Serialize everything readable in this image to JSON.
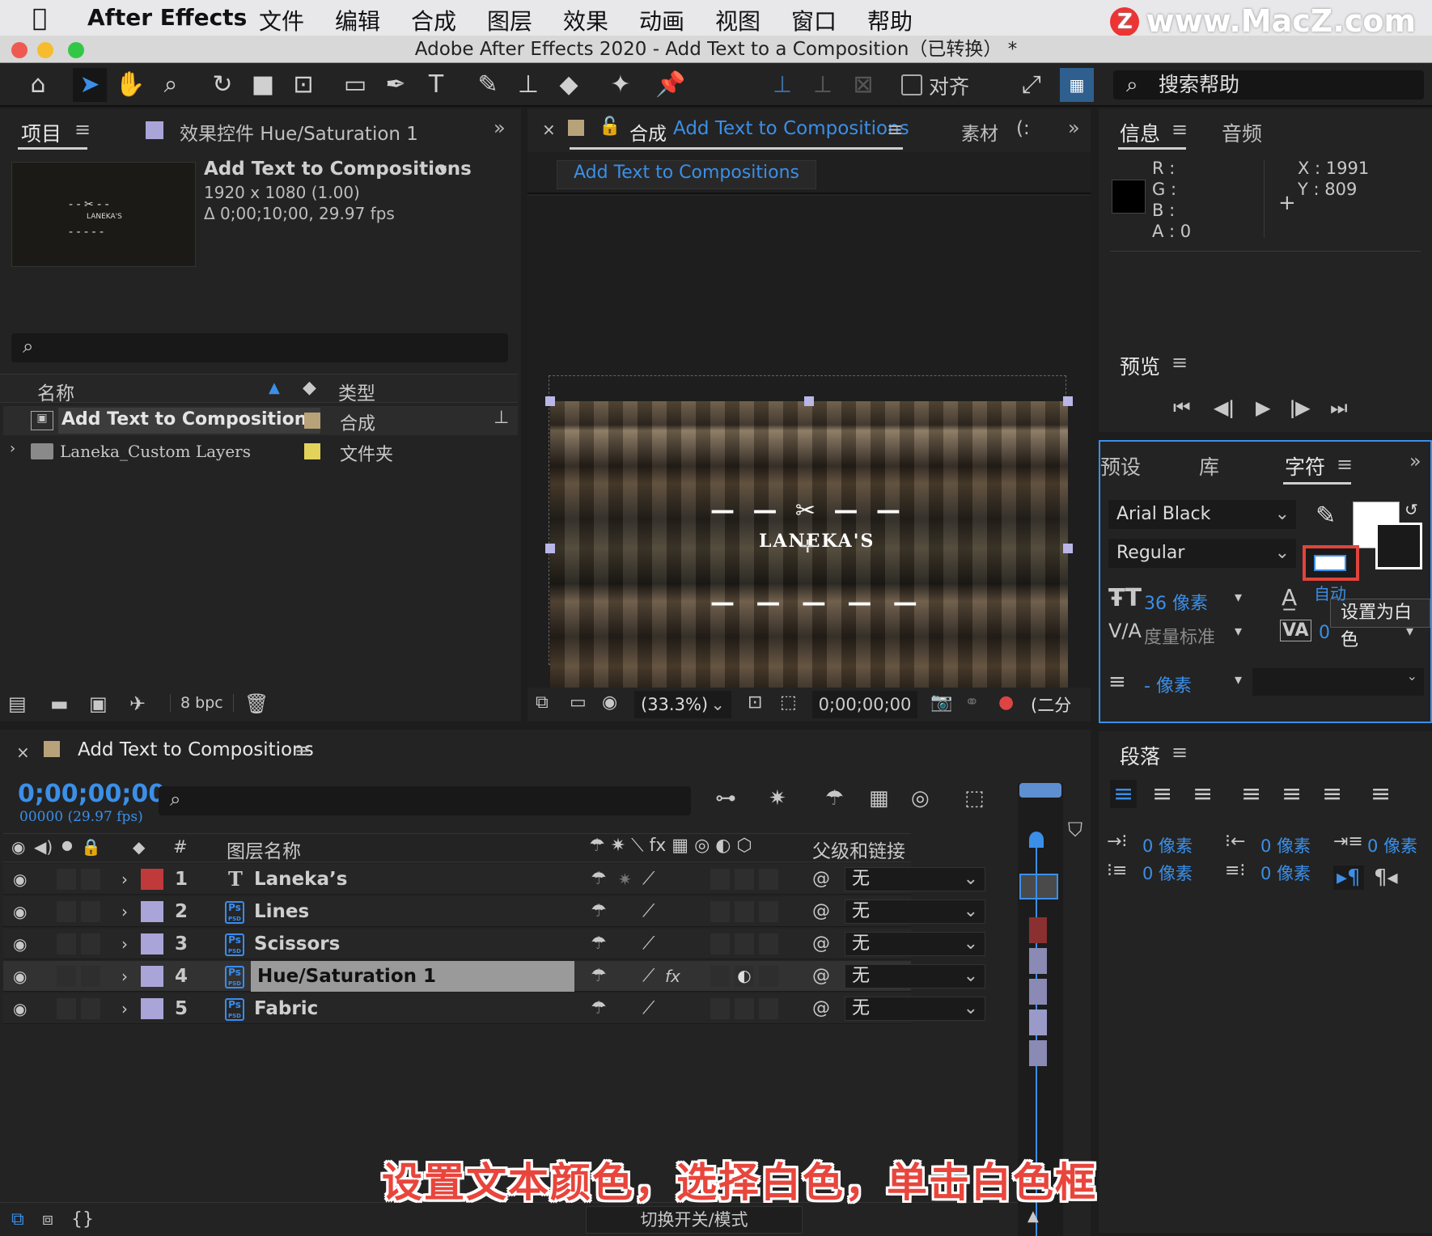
{
  "menubar": {
    "apple": "",
    "items": [
      "After Effects",
      "文件",
      "编辑",
      "合成",
      "图层",
      "效果",
      "动画",
      "视图",
      "窗口",
      "帮助"
    ],
    "watermark": "www.MacZ.com",
    "watermark_badge": "Z"
  },
  "window": {
    "title": "Adobe After Effects 2020 - Add Text to a Composition（已转换） *"
  },
  "toolbar": {
    "align_label": "对齐",
    "search_placeholder": "搜索帮助"
  },
  "project_panel": {
    "tab_project": "项目",
    "tab_effects": "效果控件 Hue/Saturation 1",
    "comp_name": "Add Text to Compositions",
    "comp_name_arrow": "▾",
    "resolution": "1920 x 1080 (1.00)",
    "duration": "Δ 0;00;10;00, 29.97 fps",
    "thumb_text": "LANEKA'S",
    "search_placeholder": "",
    "col_name": "名称",
    "col_type": "类型",
    "items": [
      {
        "name": "Add Text to Compositions",
        "type": "合成",
        "color": "#b8a27a"
      },
      {
        "name": "Laneka_Custom Layers",
        "type": "文件夹",
        "color": "#e3d35a"
      }
    ],
    "bpc": "8 bpc"
  },
  "comp_panel": {
    "tab_prefix": "合成",
    "tab_name": "Add Text to Compositions",
    "tab_footage": "素材",
    "tab_footage_extra": "(:",
    "breadcrumb": "Add Text to Compositions",
    "brand_text": "LANEKA'S",
    "zoom": "(33.3%)",
    "timecode": "0;00;00;00",
    "view_label": "(二分"
  },
  "info_panel": {
    "tab_info": "信息",
    "tab_audio": "音频",
    "r_label": "R :",
    "g_label": "G :",
    "b_label": "B :",
    "a_label": "A :  0",
    "x_label": "X : 1991",
    "y_label": "Y :  809"
  },
  "preview_panel": {
    "title": "预览"
  },
  "character_panel": {
    "tab_presets": "预设",
    "tab_library": "库",
    "tab_character": "字符",
    "font_family": "Arial Black",
    "font_style": "Regular",
    "font_size": "36 像素",
    "leading": "自动",
    "kerning": "度量标准",
    "tracking": "0",
    "stroke_width": "- 像素",
    "tooltip": "设置为白色"
  },
  "paragraph_panel": {
    "title": "段落",
    "indent_left": "0 像素",
    "indent_right": "0 像素",
    "indent_first": "0 像素",
    "space_before": "0 像素",
    "space_after": "0 像素"
  },
  "timeline": {
    "tab_name": "Add Text to Compositions",
    "timecode": "0;00;00;00",
    "frames": "00000 (29.97 fps)",
    "col_layer_name": "图层名称",
    "col_parent": "父级和链接",
    "col_hash": "#",
    "layers": [
      {
        "num": "1",
        "name": "Laneka’s",
        "kind": "text",
        "color": "#c0393b",
        "parent": "无"
      },
      {
        "num": "2",
        "name": "Lines",
        "kind": "ps",
        "color": "#a9a5d8",
        "parent": "无"
      },
      {
        "num": "3",
        "name": "Scissors",
        "kind": "ps",
        "color": "#a9a5d8",
        "parent": "无"
      },
      {
        "num": "4",
        "name": "Hue/Saturation 1",
        "kind": "ps",
        "color": "#a9a5d8",
        "parent": "无"
      },
      {
        "num": "5",
        "name": "Fabric",
        "kind": "ps",
        "color": "#a9a5d8",
        "parent": "无"
      }
    ],
    "ps_icon_label": "Ps",
    "ps_icon_sub": "PSD",
    "toggle_label": "切换开关/模式"
  },
  "caption": "设置文本颜色，选择白色，单击白色框",
  "colors": {
    "accent_blue": "#3b8fe8",
    "highlight_red": "#e0443c",
    "caption_red": "#e8453c"
  }
}
